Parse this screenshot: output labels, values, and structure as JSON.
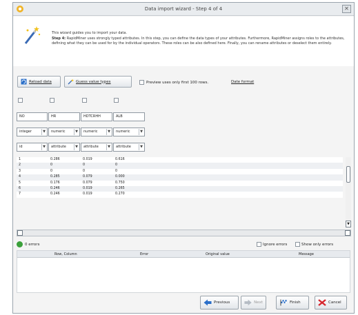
{
  "window": {
    "title": "Data import wizard - Step 4 of 4",
    "close_label": "✕"
  },
  "intro": {
    "line1": "This wizard guides you to import your data.",
    "step_label": "Step 4:",
    "line2": "RapidMiner uses strongly typed attributes. In this step, you can define the data types of your attributes. Furthermore, RapidMiner assigns roles to the attributes, defining what they can be used for by the individual operators. These roles can be also defined here. Finally, you can rename attributes or deselect them entirely."
  },
  "toolbar": {
    "reload_label": "Reload data",
    "guess_label": "Guess value types",
    "preview_label": "Preview uses only first 100 rows.",
    "date_format_label": "Date format"
  },
  "columns": [
    {
      "name": "NO",
      "type": "integer",
      "role": "id"
    },
    {
      "name": "HR",
      "type": "numeric",
      "role": "attribute"
    },
    {
      "name": "HDTCRHH",
      "type": "numeric",
      "role": "attribute"
    },
    {
      "name": "ALB",
      "type": "numeric",
      "role": "attribute"
    }
  ],
  "rows": [
    [
      "1",
      "0.286",
      "0.019",
      "0.616"
    ],
    [
      "2",
      "0",
      "0",
      "0"
    ],
    [
      "3",
      "0",
      "0",
      "0"
    ],
    [
      "4",
      "0.285",
      "0.079",
      "0.000"
    ],
    [
      "5",
      "0.176",
      "0.079",
      "0.750"
    ],
    [
      "6",
      "0.246",
      "0.019",
      "0.265"
    ],
    [
      "7",
      "0.246",
      "0.019",
      "0.270"
    ]
  ],
  "status": {
    "errors_label": "0 errors",
    "ignore_errors_label": "Ignore errors",
    "show_only_errors_label": "Show only errors"
  },
  "error_table": {
    "headers": [
      "Row, Column",
      "Error",
      "Original value",
      "Message"
    ]
  },
  "footer": {
    "previous_label": "Previous",
    "next_label": "Next",
    "finish_label": "Finish",
    "cancel_label": "Cancel"
  },
  "colors": {
    "accent": "#2a6fc9",
    "ok": "#3ba03b",
    "cancel": "#d6262d"
  }
}
